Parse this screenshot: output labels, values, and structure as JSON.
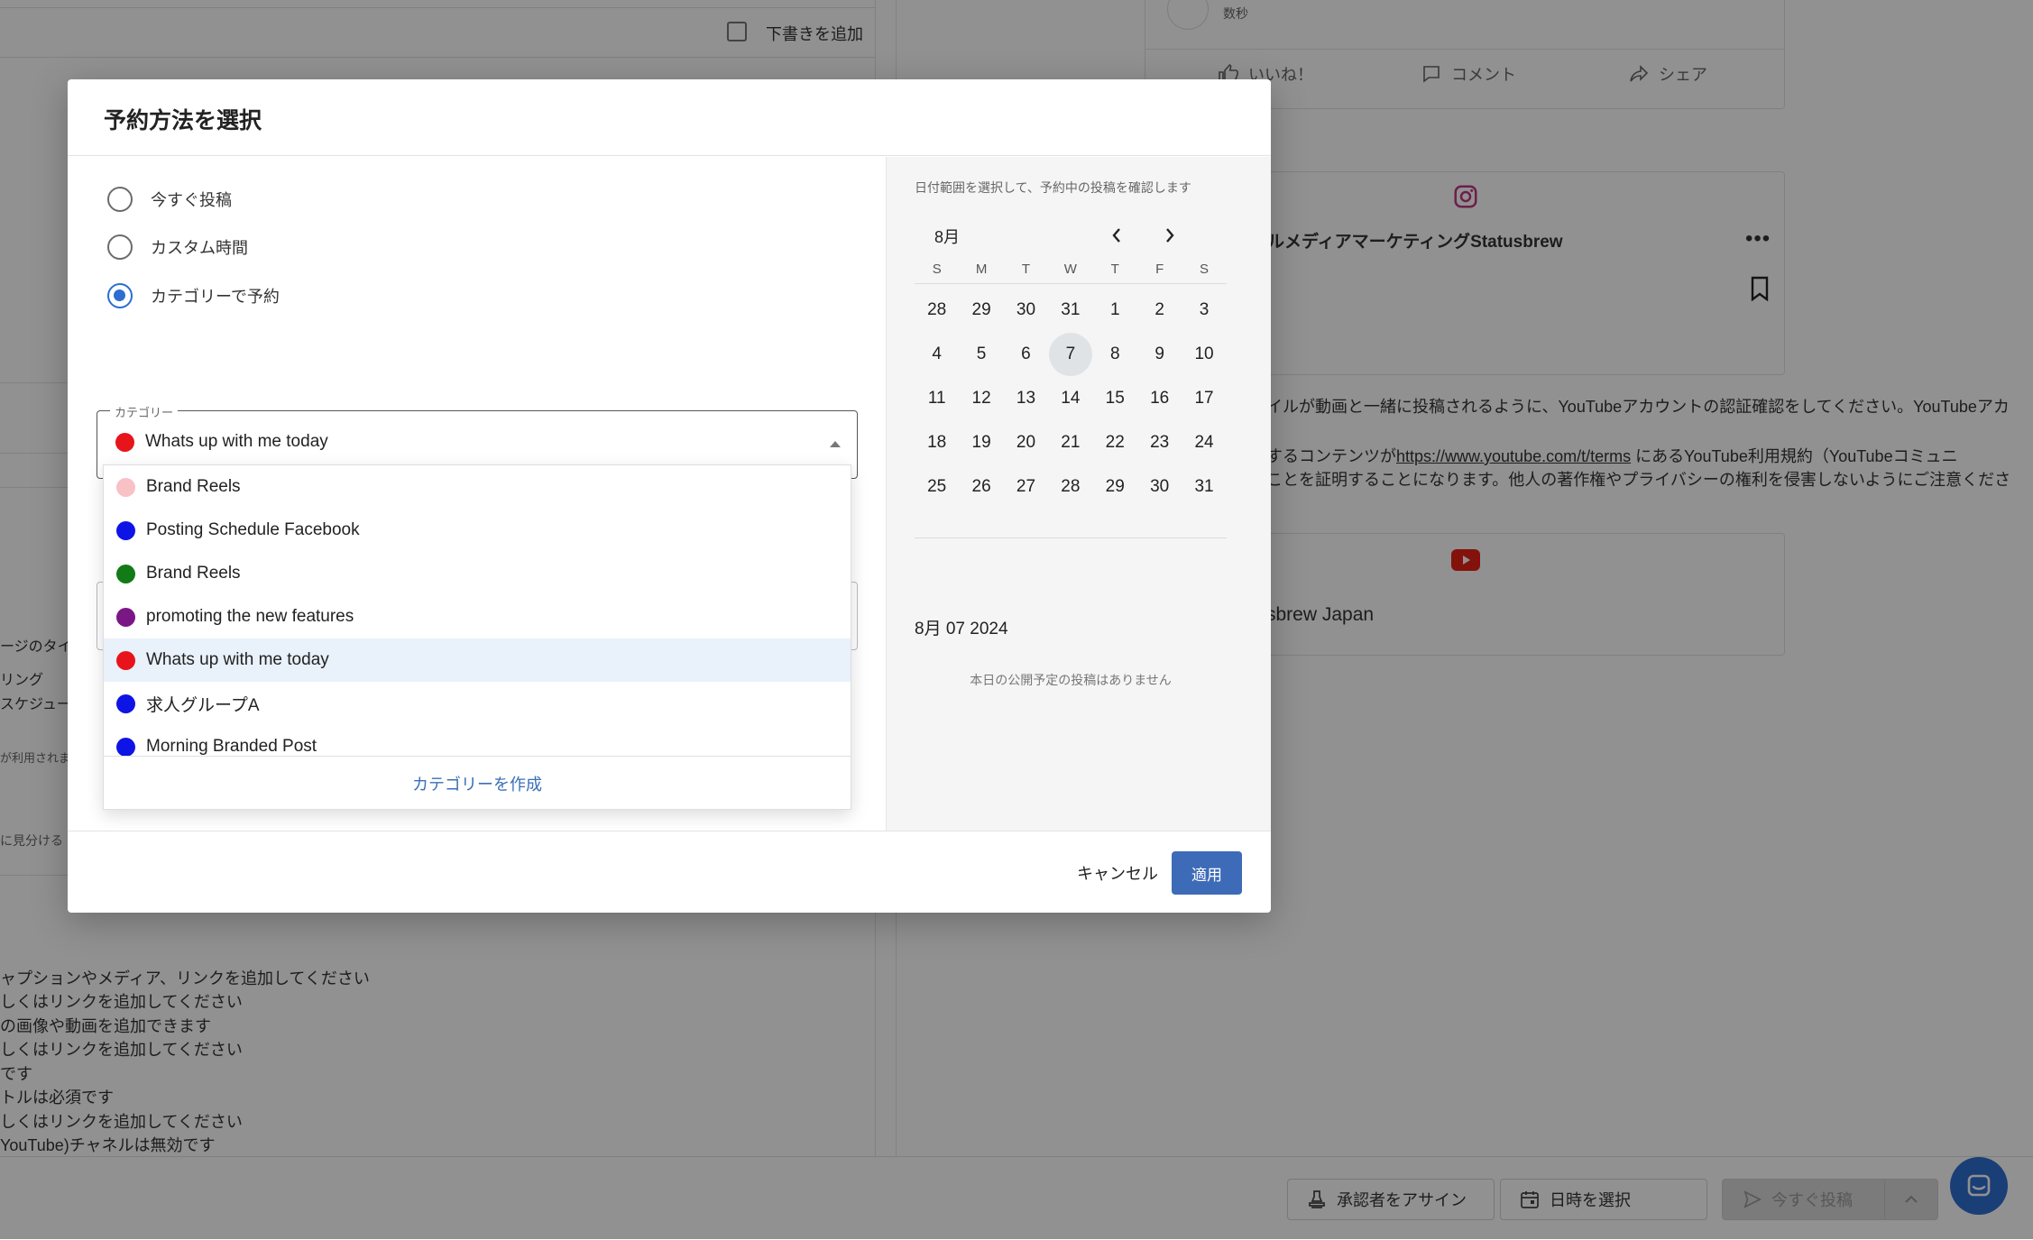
{
  "background": {
    "draft_checkbox_label": "下書きを追加",
    "time_ago": "数秒",
    "actions": {
      "like": "いいね！",
      "comment": "コメント",
      "share": "シェア"
    },
    "instagram_account": "ルメディアマーケティングStatusbrew",
    "youtube_notice_1": "イルが動画と一緒に投稿されるように、YouTubeアカウントの認証確認をしてください。YouTubeアカ",
    "youtube_notice_2a": "するコンテンツが",
    "youtube_notice_2_link": "https://www.youtube.com/t/terms",
    "youtube_notice_2b": " にあるYouTube利用規約（YouTubeコミュニ",
    "youtube_notice_3": "ことを証明することになります。他人の著作権やプライバシーの権利を侵害しないようにご注意くださ",
    "youtube_account": "sbrew Japan",
    "left_fragments": [
      "ージのタイム",
      "リング",
      "スケジュー",
      "が利用されま",
      "に見分ける"
    ],
    "errors": [
      "ャプションやメディア、リンクを追加してください",
      "しくはリンクを追加してください",
      "の画像や動画を追加できます",
      "しくはリンクを追加してください",
      "です",
      "トルは必須です",
      "しくはリンクを追加してください",
      "YouTube)チャネルは無効です"
    ],
    "bottom_bar": {
      "assign_approver": "承認者をアサイン",
      "pick_datetime": "日時を選択",
      "post_now": "今すぐ投稿"
    }
  },
  "modal": {
    "title": "予約方法を選択",
    "options": [
      {
        "label": "今すぐ投稿",
        "checked": false
      },
      {
        "label": "カスタム時間",
        "checked": false
      },
      {
        "label": "カテゴリーで予約",
        "checked": true
      }
    ],
    "category_field": {
      "legend": "カテゴリー",
      "value": "Whats up with me today",
      "value_color": "#e8141b"
    },
    "dropdown": {
      "items": [
        {
          "label": "Brand Reels",
          "color": "#f7c1c6",
          "selected": false
        },
        {
          "label": "Posting Schedule Facebook",
          "color": "#0f14e6",
          "selected": false
        },
        {
          "label": "Brand Reels",
          "color": "#127a17",
          "selected": false
        },
        {
          "label": "promoting the new features",
          "color": "#7a1785",
          "selected": false
        },
        {
          "label": "Whats up with me today",
          "color": "#e8141b",
          "selected": true
        },
        {
          "label": "求人グループA",
          "color": "#0f14e6",
          "selected": false
        },
        {
          "label": "Morning Branded Post",
          "color": "#0f14e6",
          "selected": false
        }
      ],
      "create_label": "カテゴリーを作成"
    },
    "calendar": {
      "hint": "日付範囲を選択して、予約中の投稿を確認します",
      "month": "8月",
      "weekdays": [
        "S",
        "M",
        "T",
        "W",
        "T",
        "F",
        "S"
      ],
      "weeks": [
        [
          "28",
          "29",
          "30",
          "31",
          "1",
          "2",
          "3"
        ],
        [
          "4",
          "5",
          "6",
          "7",
          "8",
          "9",
          "10"
        ],
        [
          "11",
          "12",
          "13",
          "14",
          "15",
          "16",
          "17"
        ],
        [
          "18",
          "19",
          "20",
          "21",
          "22",
          "23",
          "24"
        ],
        [
          "25",
          "26",
          "27",
          "28",
          "29",
          "30",
          "31"
        ]
      ],
      "today": "7",
      "selected_date": "8月 07 2024",
      "empty_message": "本日の公開予定の投稿はありません"
    },
    "buttons": {
      "cancel": "キャンセル",
      "apply": "適用"
    }
  }
}
